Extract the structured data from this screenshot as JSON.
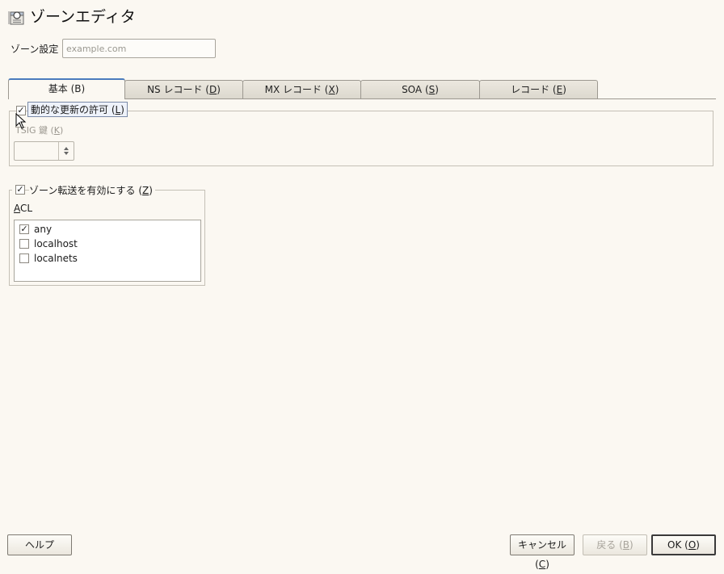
{
  "window": {
    "title": "ゾーンエディタ",
    "icon": "dns-server-icon"
  },
  "zone": {
    "label": "ゾーン設定",
    "placeholder": "example.com",
    "value": ""
  },
  "tabs": [
    {
      "label": "基本 (B)",
      "active": true
    },
    {
      "label_pre": "NS レコード (",
      "mnemonic": "D",
      "label_post": ")"
    },
    {
      "label_pre": "MX レコード (",
      "mnemonic": "X",
      "label_post": ")"
    },
    {
      "label_pre": "SOA (",
      "mnemonic": "S",
      "label_post": ")"
    },
    {
      "label_pre": "レコード (",
      "mnemonic": "E",
      "label_post": ")"
    }
  ],
  "ddns": {
    "label_pre": "動的な更新の許可 (",
    "mnemonic": "L",
    "label_post": ")",
    "checked": true,
    "tsig_label_pre": "TSIG 鍵 (",
    "tsig_mnemonic": "K",
    "tsig_label_post": ")",
    "tsig_value": ""
  },
  "transfer": {
    "label_pre": "ゾーン転送を有効にする (",
    "mnemonic": "Z",
    "label_post": ")",
    "checked": true,
    "acl_mnemonic": "A",
    "acl_rest": "CL",
    "acl_items": [
      {
        "label": "any",
        "checked": true
      },
      {
        "label": "localhost",
        "checked": false
      },
      {
        "label": "localnets",
        "checked": false
      }
    ]
  },
  "buttons": {
    "help": "ヘルプ",
    "cancel_pre": "キャンセル (",
    "cancel_mnemonic": "C",
    "cancel_post": ")",
    "back_pre": "戻る (",
    "back_mnemonic": "B",
    "back_post": ")",
    "ok_pre": "OK (",
    "ok_mnemonic": "O",
    "ok_post": ")"
  },
  "colors": {
    "background": "#fbf8f2",
    "tab_accent": "#4a7bbd",
    "tooltip_bg": "#eef2fa"
  }
}
